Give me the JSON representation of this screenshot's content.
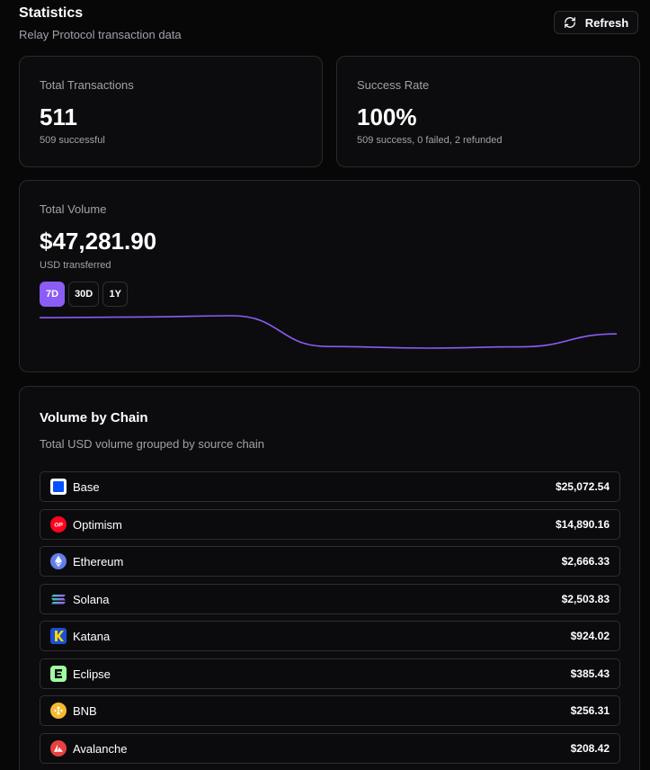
{
  "header": {
    "title": "Statistics",
    "subtitle": "Relay Protocol transaction data",
    "refresh_label": "Refresh"
  },
  "total_transactions": {
    "label": "Total Transactions",
    "value": "511",
    "caption": "509 successful"
  },
  "success_rate": {
    "label": "Success Rate",
    "value": "100%",
    "caption": "509 success, 0 failed, 2 refunded"
  },
  "total_volume": {
    "label": "Total Volume",
    "value": "$47,281.90",
    "caption": "USD transferred",
    "ranges": [
      "7D",
      "30D",
      "1Y"
    ],
    "active_range": "7D",
    "line_color": "#8b5cf6",
    "trend": [
      0.94,
      0.96,
      1.0,
      0.05,
      0.0,
      0.04,
      0.44
    ]
  },
  "volume_by_chain": {
    "title": "Volume by Chain",
    "description": "Total USD volume grouped by source chain",
    "chains": [
      {
        "name": "Base",
        "amount": "$25,072.54",
        "icon": "base-icon",
        "color": "#0052ff"
      },
      {
        "name": "Optimism",
        "amount": "$14,890.16",
        "icon": "optimism-icon",
        "color": "#ff0420"
      },
      {
        "name": "Ethereum",
        "amount": "$2,666.33",
        "icon": "ethereum-icon",
        "color": "#627eea"
      },
      {
        "name": "Solana",
        "amount": "$2,503.83",
        "icon": "solana-icon",
        "color": "#9945ff"
      },
      {
        "name": "Katana",
        "amount": "$924.02",
        "icon": "katana-icon",
        "color": "#f5d90a"
      },
      {
        "name": "Eclipse",
        "amount": "$385.43",
        "icon": "eclipse-icon",
        "color": "#a1fea0"
      },
      {
        "name": "BNB",
        "amount": "$256.31",
        "icon": "bnb-icon",
        "color": "#f3ba2f"
      },
      {
        "name": "Avalanche",
        "amount": "$208.42",
        "icon": "avalanche-icon",
        "color": "#e84142"
      }
    ]
  }
}
